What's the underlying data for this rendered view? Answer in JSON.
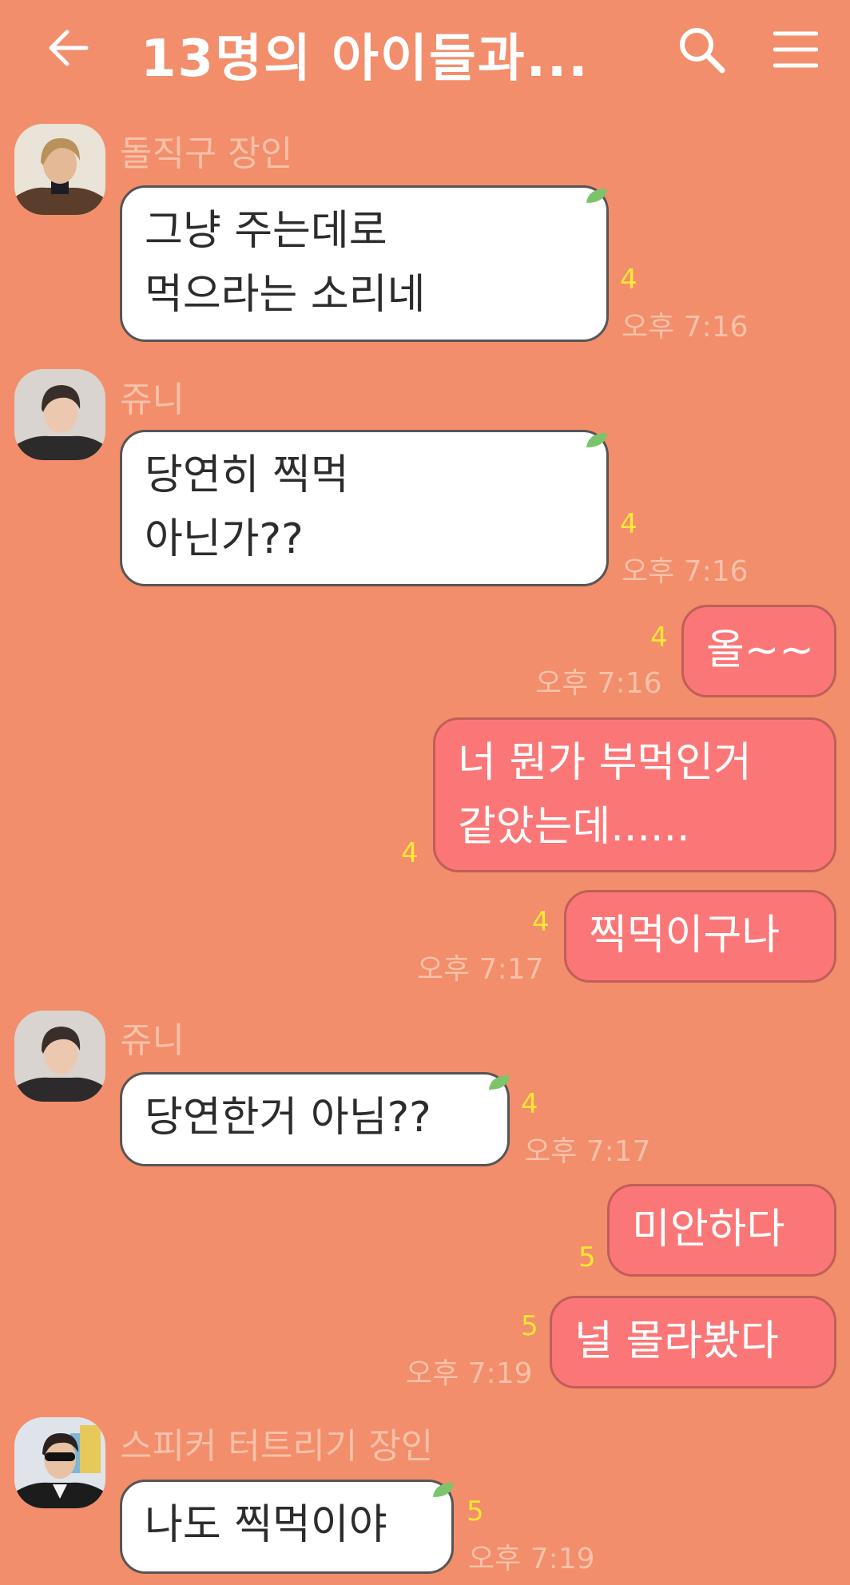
{
  "header": {
    "title": "13명의 아이들과...",
    "back_icon": "arrow-left-icon",
    "search_icon": "search-icon",
    "menu_icon": "hamburger-menu-icon"
  },
  "colors": {
    "background": "#F28E6B",
    "incoming_bubble": "#FFFFFF",
    "outgoing_bubble": "#FB7777",
    "unread_count": "#FFE735",
    "meta_text": "#F9C1AA"
  },
  "messages": [
    {
      "sender": "돌직구 장인",
      "lines": [
        "그냥 주는데로",
        "먹으라는 소리네"
      ],
      "unread": "4",
      "time": "오후 7:16"
    },
    {
      "sender": "쥬니",
      "lines": [
        "당연히 찍먹",
        "아닌가??"
      ],
      "unread": "4",
      "time": "오후 7:16"
    },
    {
      "lines": [
        "올~~"
      ],
      "unread": "4",
      "time": "오후 7:16"
    },
    {
      "lines": [
        "너 뭔가 부먹인거",
        "같았는데......"
      ],
      "unread": "4"
    },
    {
      "lines": [
        "찍먹이구나"
      ],
      "unread": "4",
      "time": "오후 7:17"
    },
    {
      "sender": "쥬니",
      "lines": [
        "당연한거 아님??"
      ],
      "unread": "4",
      "time": "오후 7:17"
    },
    {
      "lines": [
        "미안하다"
      ],
      "unread": "5"
    },
    {
      "lines": [
        "널 몰라봤다"
      ],
      "unread": "5",
      "time": "오후 7:19"
    },
    {
      "sender": "스피커 터트리기 장인",
      "lines": [
        "나도 찍먹이야"
      ],
      "unread": "5",
      "time": "오후 7:19"
    }
  ]
}
